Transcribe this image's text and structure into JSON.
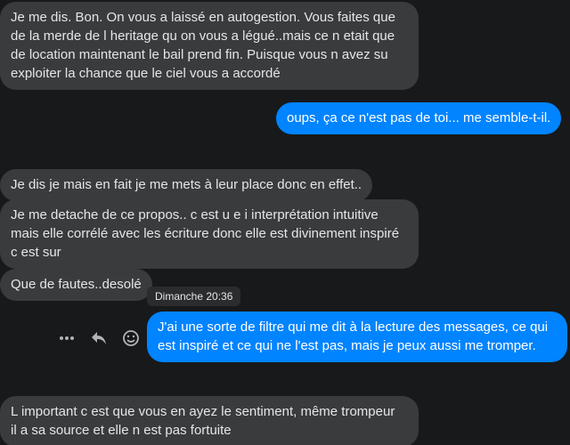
{
  "colors": {
    "background": "#18191a",
    "incoming_bubble": "#3a3b3c",
    "outgoing_bubble": "#0084ff",
    "text_light": "#e4e6eb",
    "icon": "#b0b3b8"
  },
  "messages": [
    {
      "side": "in",
      "text": "Je me dis. Bon. On vous a laissé en autogestion. Vous faites que\nde la merde de l heritage qu on vous a légué..mais ce n etait que\nde location maintenant le bail prend fin. Puisque vous n avez su\nexploiter la chance que le ciel vous a accordé"
    },
    {
      "side": "out",
      "text": "oups, ça ce n'est pas de toi... me semble-t-il."
    },
    {
      "side": "in",
      "text": "Je dis je mais en fait je me mets à leur place donc en effet.."
    },
    {
      "side": "in",
      "text": "Je me detache de ce propos.. c est u e i interprétation intuitive\nmais elle corrélé avec les écriture donc elle est divinement inspiré\nc est sur"
    },
    {
      "side": "in",
      "text": "Que de fautes..desolé"
    },
    {
      "side": "out",
      "text": "J'ai une sorte de filtre qui me dit à la lecture des messages, ce qui\nest inspiré et ce qui ne l'est pas, mais je peux aussi me tromper."
    },
    {
      "side": "in",
      "text": "L important c est que vous en ayez le sentiment, même trompeur\nil a sa source et elle n est pas fortuite"
    }
  ],
  "tooltip": {
    "text": "Dimanche 20:36"
  },
  "actions": [
    {
      "icon": "more-icon"
    },
    {
      "icon": "reply-icon"
    },
    {
      "icon": "emoji-icon"
    }
  ]
}
